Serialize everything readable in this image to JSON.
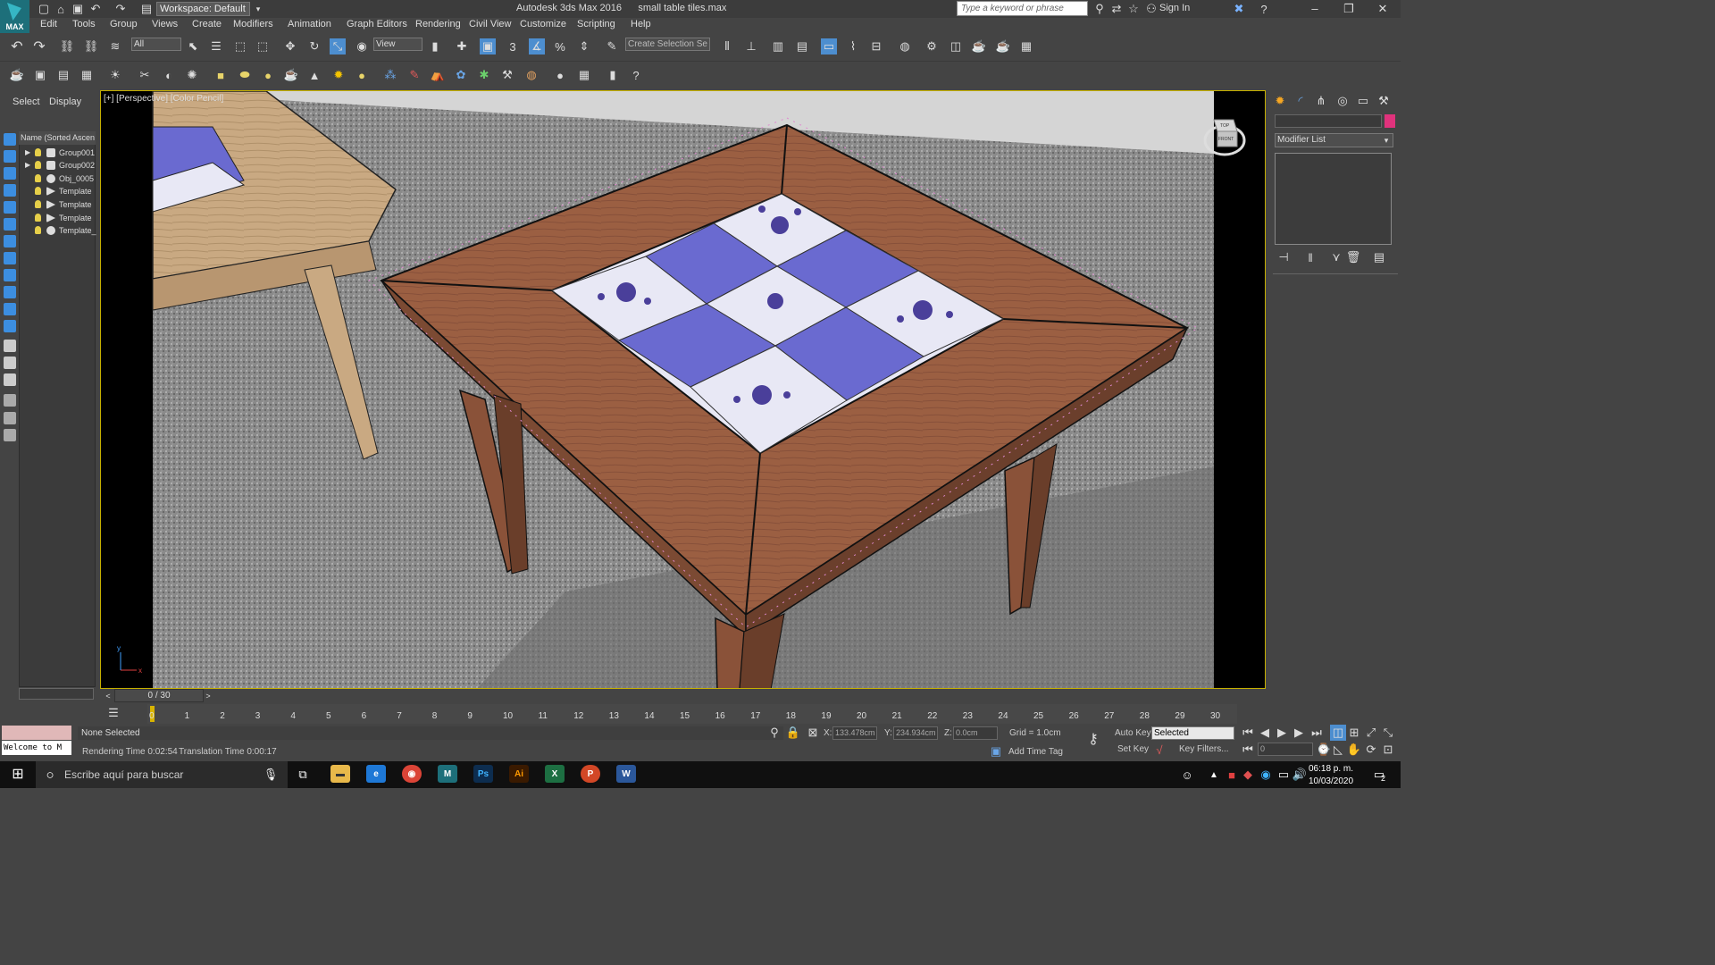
{
  "title_bar": {
    "workspace": "Workspace: Default",
    "app_title": "Autodesk 3ds Max 2016      small table tiles.max",
    "search_placeholder": "Type a keyword or phrase",
    "sign_in": "Sign In",
    "logo_text": "MAX"
  },
  "menu": [
    "Edit",
    "Tools",
    "Group",
    "Views",
    "Create",
    "Modifiers",
    "Animation",
    "Graph Editors",
    "Rendering",
    "Civil View",
    "Customize",
    "Scripting",
    "Help"
  ],
  "toolbar": {
    "selection_filter": "All",
    "ref_coord": "View",
    "named_selection": "Create Selection Se"
  },
  "scene_explorer": {
    "tabs": [
      "Select",
      "Display"
    ],
    "column_header": "Name (Sorted Ascen",
    "items": [
      {
        "name": "Group001",
        "type": "group"
      },
      {
        "name": "Group002",
        "type": "group"
      },
      {
        "name": "Obj_0005",
        "type": "object"
      },
      {
        "name": "Template",
        "type": "light"
      },
      {
        "name": "Template",
        "type": "light"
      },
      {
        "name": "Template",
        "type": "light"
      },
      {
        "name": "Template_",
        "type": "object"
      }
    ]
  },
  "viewport": {
    "label": "[+] [Perspective] [Color Pencil]",
    "viewcube_top": "TOP",
    "viewcube_front": "FRONT",
    "axis_x": "x",
    "axis_y": "y"
  },
  "command_panel": {
    "modifier_list": "Modifier List"
  },
  "time_slider": {
    "frame": "0 / 30",
    "ticks": [
      "0",
      "1",
      "2",
      "3",
      "4",
      "5",
      "6",
      "7",
      "8",
      "9",
      "10",
      "11",
      "12",
      "13",
      "14",
      "15",
      "16",
      "17",
      "18",
      "19",
      "20",
      "21",
      "22",
      "23",
      "24",
      "25",
      "26",
      "27",
      "28",
      "29",
      "30"
    ]
  },
  "status": {
    "welcome": "Welcome to M",
    "selection": "None Selected",
    "rendering_time": "Rendering Time  0:02:54",
    "translation_time": "Translation Time  0:00:17",
    "x_label": "X:",
    "x_value": "133.478cm",
    "y_label": "Y:",
    "y_value": "234.934cm",
    "z_label": "Z:",
    "z_value": "0.0cm",
    "grid": "Grid = 1.0cm",
    "auto_key": "Auto Key",
    "selected": "Selected",
    "set_key": "Set Key",
    "key_filters": "Key Filters...",
    "frame_field": "0",
    "add_time_tag": "Add Time Tag"
  },
  "taskbar": {
    "search_placeholder": "Escribe aquí para buscar",
    "apps": [
      "Ps",
      "Ai",
      "X",
      "P",
      "W"
    ],
    "time": "06:18 p. m.",
    "date": "10/03/2020",
    "notification_count": "2"
  }
}
